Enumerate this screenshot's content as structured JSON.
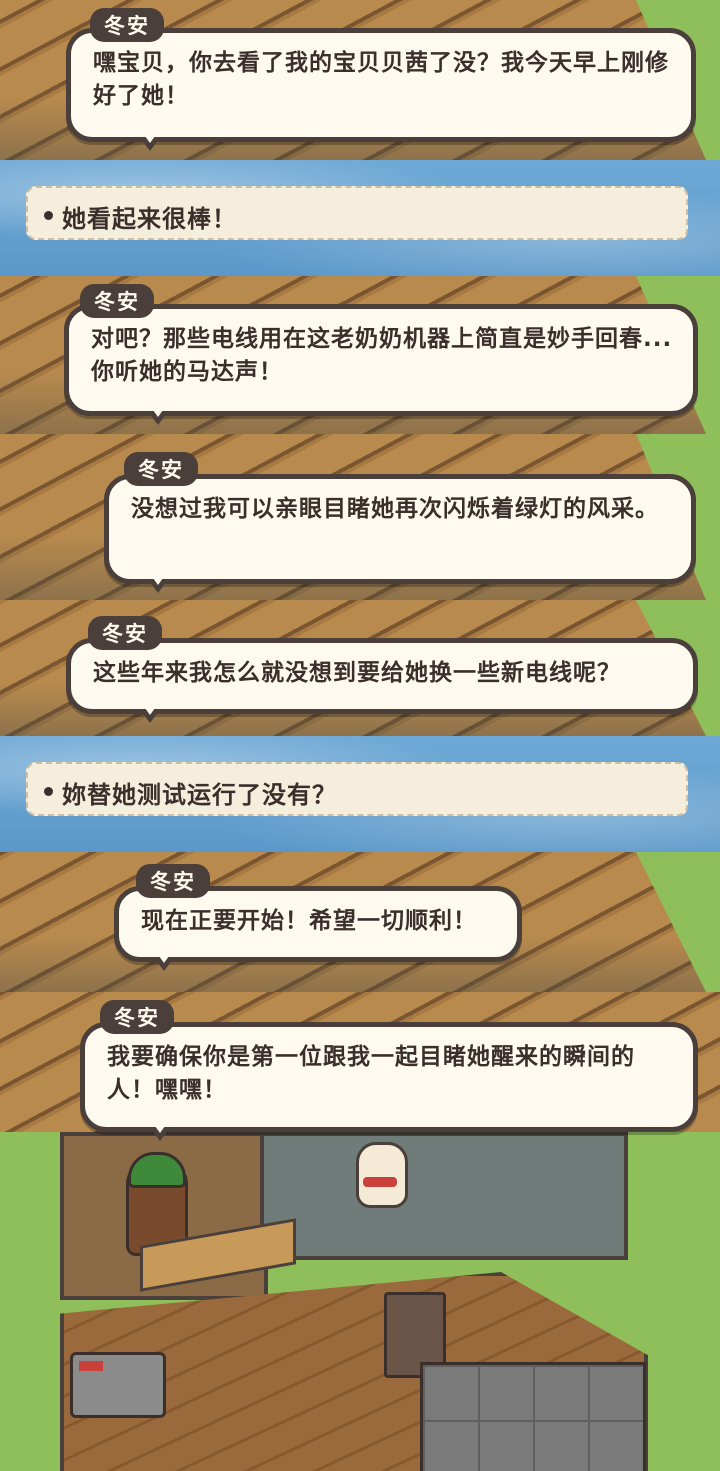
{
  "dialogues": [
    {
      "speaker": "冬安",
      "text": "嘿宝贝，你去看了我的宝贝贝茜了没？我今天早上刚修好了她！"
    },
    {
      "speaker": "冬安",
      "text": "对吧？那些电线用在这老奶奶机器上简直是妙手回春...你听她的马达声！"
    },
    {
      "speaker": "冬安",
      "text": "没想过我可以亲眼目睹她再次闪烁着绿灯的风采。"
    },
    {
      "speaker": "冬安",
      "text": "这些年来我怎么就没想到要给她换一些新电线呢？"
    },
    {
      "speaker": "冬安",
      "text": "现在正要开始！希望一切顺利！"
    },
    {
      "speaker": "冬安",
      "text": "我要确保你是第一位跟我一起目睹她醒来的瞬间的人！嘿嘿！"
    }
  ],
  "choices": [
    {
      "text": "她看起来很棒！"
    },
    {
      "text": "妳替她测试运行了没有？"
    }
  ]
}
